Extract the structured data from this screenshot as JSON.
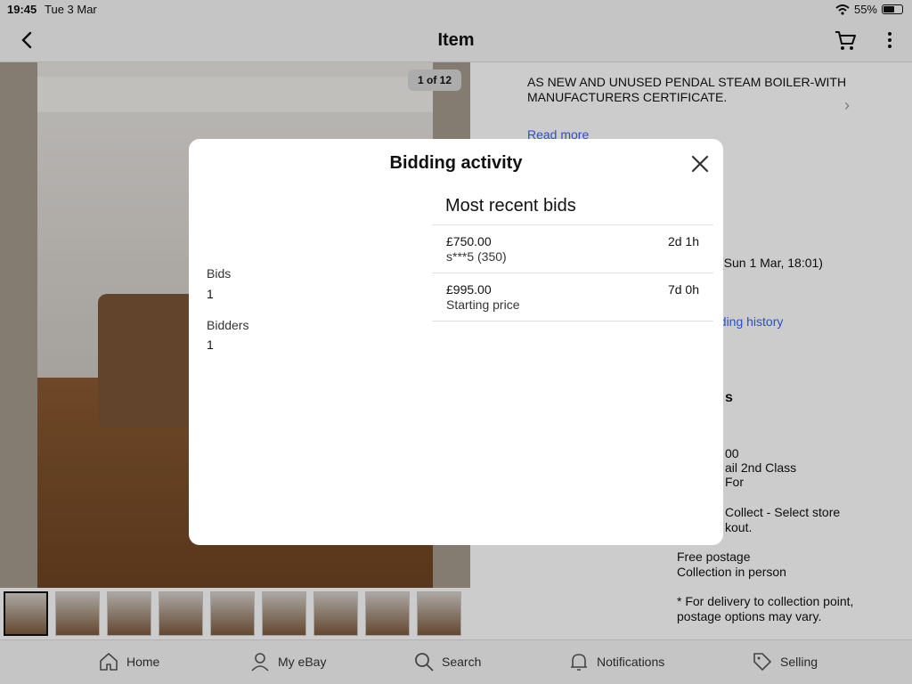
{
  "status_bar": {
    "time": "19:45",
    "date": "Tue 3 Mar",
    "battery": "55%"
  },
  "nav": {
    "title": "Item"
  },
  "gallery": {
    "counter": "1 of 12"
  },
  "details": {
    "description": "AS NEW AND UNUSED PENDAL STEAM BOILER-WITH MANUFACTURERS CERTIFICATE.",
    "read_more": "Read more",
    "end_date_fragment": "(Sun 1 Mar, 18:01)",
    "history_fragment": "dding history",
    "section_fragment": "s",
    "price_fragment": "00",
    "royal_fragment": "ail 2nd Class",
    "for_fragment": "For",
    "collect_fragment": "Collect - Select store",
    "kout_fragment": "kout.",
    "free_postage": "Free postage",
    "collection": "Collection in person",
    "note": "* For delivery to collection point, postage options may vary."
  },
  "tabs": [
    {
      "label": "Home",
      "icon": "home-icon"
    },
    {
      "label": "My eBay",
      "icon": "person-icon"
    },
    {
      "label": "Search",
      "icon": "search-icon"
    },
    {
      "label": "Notifications",
      "icon": "bell-icon"
    },
    {
      "label": "Selling",
      "icon": "tag-icon"
    }
  ],
  "modal": {
    "title": "Bidding activity",
    "bids_label": "Bids",
    "bids_value": "1",
    "bidders_label": "Bidders",
    "bidders_value": "1",
    "recent_heading": "Most recent bids",
    "bids": [
      {
        "amount": "£750.00",
        "bidder": "s***5 (350)",
        "time": "2d 1h"
      },
      {
        "amount": "£995.00",
        "bidder": "Starting price",
        "time": "7d 0h"
      }
    ]
  },
  "colors": {
    "link": "#3665f3",
    "overlay": "rgba(0,0,0,0.2)"
  }
}
